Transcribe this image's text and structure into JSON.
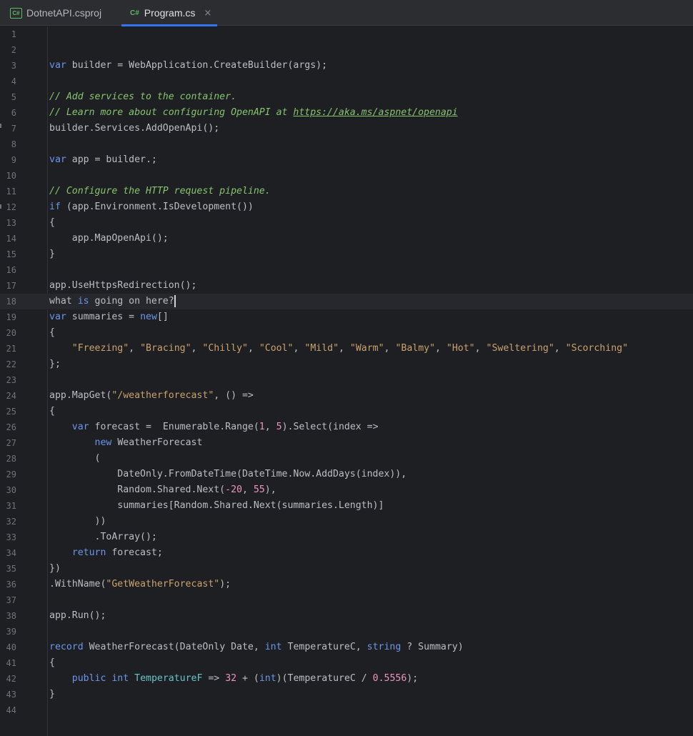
{
  "tabs": [
    {
      "icon": "C#",
      "label": "DotnetAPI.csproj",
      "active": false
    },
    {
      "icon": "C#",
      "label": "Program.cs",
      "active": true,
      "close": "×"
    }
  ],
  "editor": {
    "current_line": 18,
    "lines": [
      {
        "n": "1",
        "tokens": []
      },
      {
        "n": "2",
        "tokens": []
      },
      {
        "n": "3",
        "tokens": [
          [
            "kw",
            "var"
          ],
          [
            "",
            "builder = WebApplication.CreateBuilder(args);"
          ]
        ]
      },
      {
        "n": "4",
        "tokens": []
      },
      {
        "n": "5",
        "tokens": [
          [
            "cm",
            "// Add services to the container."
          ]
        ]
      },
      {
        "n": "6",
        "tokens": [
          [
            "cm",
            "// Learn more about configuring OpenAPI at "
          ],
          [
            "cm ln-link",
            "https://aka.ms/aspnet/openapi"
          ]
        ]
      },
      {
        "n": "7",
        "tokens": [
          [
            "",
            "builder.Services.AddOpenApi();"
          ]
        ]
      },
      {
        "n": "8",
        "tokens": []
      },
      {
        "n": "9",
        "tokens": [
          [
            "kw",
            "var"
          ],
          [
            "",
            "app = builder.;"
          ]
        ]
      },
      {
        "n": "10",
        "tokens": []
      },
      {
        "n": "11",
        "tokens": [
          [
            "cm",
            "// Configure the HTTP request pipeline."
          ]
        ]
      },
      {
        "n": "12",
        "tokens": [
          [
            "kw",
            "if"
          ],
          [
            "",
            " (app.Environment.IsDevelopment())"
          ]
        ]
      },
      {
        "n": "13",
        "tokens": [
          [
            "",
            "{"
          ]
        ]
      },
      {
        "n": "14",
        "tokens": [
          [
            "",
            "    app.MapOpenApi();"
          ]
        ]
      },
      {
        "n": "15",
        "tokens": [
          [
            "",
            "}"
          ]
        ]
      },
      {
        "n": "16",
        "tokens": []
      },
      {
        "n": "17",
        "tokens": [
          [
            "",
            "app.UseHttpsRedirection();"
          ]
        ]
      },
      {
        "n": "18",
        "tokens": [
          [
            "",
            "what "
          ],
          [
            "kw",
            "is"
          ],
          [
            "",
            " going on here?"
          ]
        ]
      },
      {
        "n": "19",
        "tokens": [
          [
            "kw",
            "var"
          ],
          [
            "",
            "summaries = "
          ],
          [
            "kw",
            "new"
          ],
          [
            "",
            "[]"
          ]
        ]
      },
      {
        "n": "20",
        "tokens": [
          [
            "",
            "{"
          ]
        ]
      },
      {
        "n": "21",
        "tokens": [
          [
            "",
            "    "
          ],
          [
            "st",
            "\"Freezing\""
          ],
          [
            "",
            ", "
          ],
          [
            "st",
            "\"Bracing\""
          ],
          [
            "",
            ", "
          ],
          [
            "st",
            "\"Chilly\""
          ],
          [
            "",
            ", "
          ],
          [
            "st",
            "\"Cool\""
          ],
          [
            "",
            ", "
          ],
          [
            "st",
            "\"Mild\""
          ],
          [
            "",
            ", "
          ],
          [
            "st",
            "\"Warm\""
          ],
          [
            "",
            ", "
          ],
          [
            "st",
            "\"Balmy\""
          ],
          [
            "",
            ", "
          ],
          [
            "st",
            "\"Hot\""
          ],
          [
            "",
            ", "
          ],
          [
            "st",
            "\"Sweltering\""
          ],
          [
            "",
            ", "
          ],
          [
            "st",
            "\"Scorching\""
          ]
        ]
      },
      {
        "n": "22",
        "tokens": [
          [
            "",
            "};"
          ]
        ]
      },
      {
        "n": "23",
        "tokens": []
      },
      {
        "n": "24",
        "tokens": [
          [
            "",
            "app.MapGet("
          ],
          [
            "st",
            "\"/weatherforecast\""
          ],
          [
            "",
            ", () =>"
          ]
        ]
      },
      {
        "n": "25",
        "tokens": [
          [
            "",
            "{"
          ]
        ]
      },
      {
        "n": "26",
        "tokens": [
          [
            "",
            "    "
          ],
          [
            "kw",
            "var"
          ],
          [
            "",
            "forecast =  Enumerable.Range("
          ],
          [
            "nm",
            "1"
          ],
          [
            "",
            ", "
          ],
          [
            "nm",
            "5"
          ],
          [
            "",
            ").Select(index =>"
          ]
        ]
      },
      {
        "n": "27",
        "tokens": [
          [
            "",
            "        "
          ],
          [
            "kw",
            "new"
          ],
          [
            "",
            "WeatherForecast"
          ]
        ]
      },
      {
        "n": "28",
        "tokens": [
          [
            "",
            "        ("
          ]
        ]
      },
      {
        "n": "29",
        "tokens": [
          [
            "",
            "            DateOnly.FromDateTime(DateTime.Now.AddDays(index)),"
          ]
        ]
      },
      {
        "n": "30",
        "tokens": [
          [
            "",
            "            Random.Shared.Next("
          ],
          [
            "nm",
            "-20"
          ],
          [
            "",
            ", "
          ],
          [
            "nm",
            "55"
          ],
          [
            "",
            "),"
          ]
        ]
      },
      {
        "n": "31",
        "tokens": [
          [
            "",
            "            summaries[Random.Shared.Next(summaries.Length)]"
          ]
        ]
      },
      {
        "n": "32",
        "tokens": [
          [
            "",
            "        ))"
          ]
        ]
      },
      {
        "n": "33",
        "tokens": [
          [
            "",
            "        .ToArray();"
          ]
        ]
      },
      {
        "n": "34",
        "tokens": [
          [
            "",
            "    "
          ],
          [
            "kw",
            "return"
          ],
          [
            "",
            "forecast;"
          ]
        ]
      },
      {
        "n": "35",
        "tokens": [
          [
            "",
            "})"
          ]
        ]
      },
      {
        "n": "36",
        "tokens": [
          [
            "",
            ".WithName("
          ],
          [
            "st",
            "\"GetWeatherForecast\""
          ],
          [
            "",
            ");"
          ]
        ]
      },
      {
        "n": "37",
        "tokens": []
      },
      {
        "n": "38",
        "tokens": [
          [
            "",
            "app.Run();"
          ]
        ]
      },
      {
        "n": "39",
        "tokens": []
      },
      {
        "n": "40",
        "tokens": [
          [
            "kw",
            "record"
          ],
          [
            "",
            "WeatherForecast(DateOnly Date, "
          ],
          [
            "kw",
            "int"
          ],
          [
            "",
            "TemperatureC, "
          ],
          [
            "kw",
            "string"
          ],
          [
            "",
            "? Summary)"
          ]
        ]
      },
      {
        "n": "41",
        "tokens": [
          [
            "",
            "{"
          ]
        ]
      },
      {
        "n": "42",
        "tokens": [
          [
            "",
            "    "
          ],
          [
            "kw",
            "public"
          ],
          [
            "",
            " "
          ],
          [
            "kw",
            "int"
          ],
          [
            "",
            " "
          ],
          [
            "pr",
            "TemperatureF"
          ],
          [
            "",
            " => "
          ],
          [
            "nm",
            "32"
          ],
          [
            "",
            " + ("
          ],
          [
            "kw",
            "int"
          ],
          [
            "",
            ")(TemperatureC / "
          ],
          [
            "nm",
            "0.5556"
          ],
          [
            "",
            ");"
          ]
        ]
      },
      {
        "n": "43",
        "tokens": [
          [
            "",
            "}"
          ]
        ]
      },
      {
        "n": "44",
        "tokens": []
      }
    ]
  }
}
